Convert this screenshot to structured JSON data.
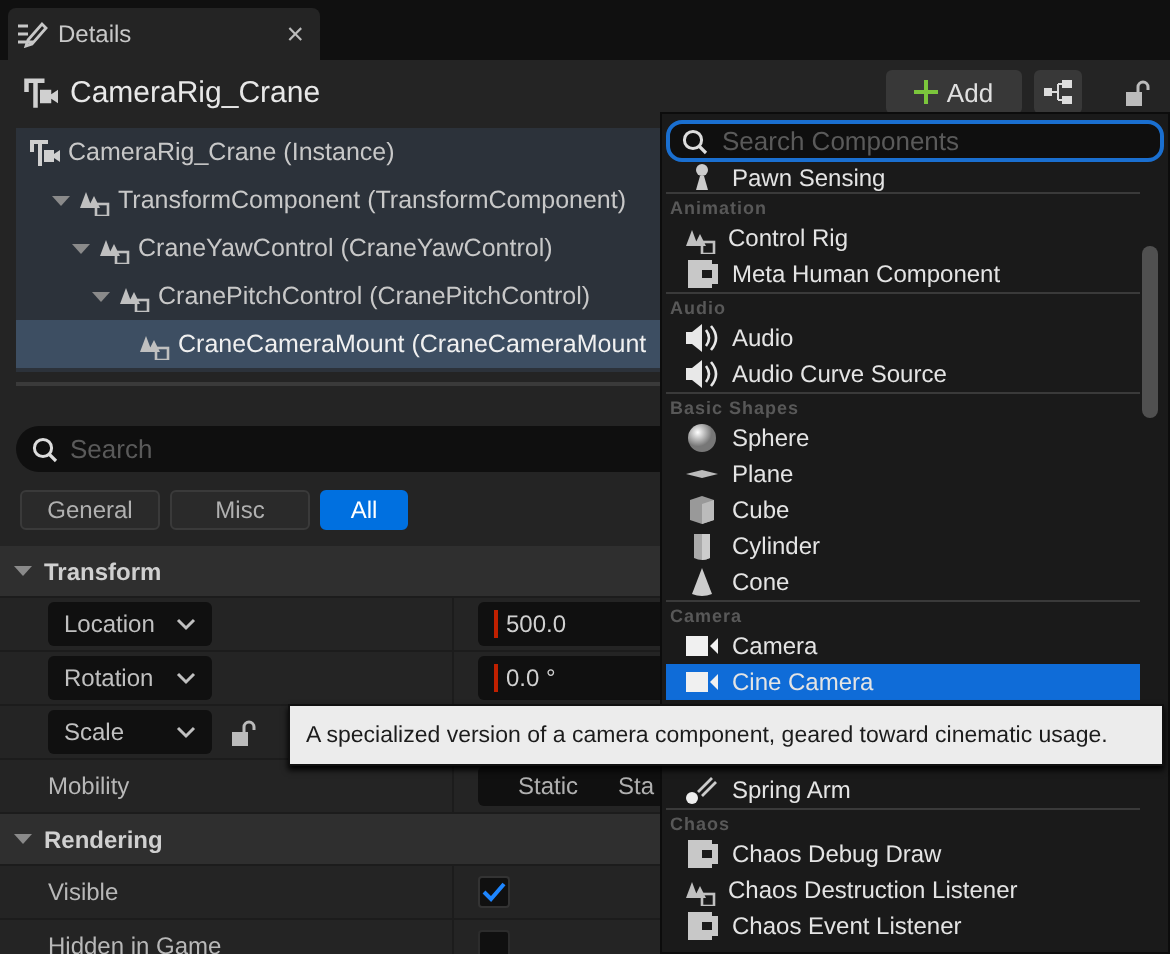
{
  "tab": {
    "title": "Details",
    "close": "×"
  },
  "header": {
    "title": "CameraRig_Crane",
    "add_button": "Add"
  },
  "tree": [
    {
      "label": "CameraRig_Crane (Instance)",
      "kind": "actor",
      "selected": false,
      "children": [
        {
          "label": "TransformComponent (TransformComponent)",
          "kind": "component",
          "expanded": true,
          "selected": false,
          "children": [
            {
              "label": "CraneYawControl (CraneYawControl)",
              "kind": "component",
              "expanded": true,
              "selected": false,
              "children": [
                {
                  "label": "CranePitchControl (CranePitchControl)",
                  "kind": "component",
                  "expanded": true,
                  "selected": false,
                  "children": [
                    {
                      "label": "CraneCameraMount (CraneCameraMount",
                      "kind": "component",
                      "selected": true
                    }
                  ]
                }
              ]
            }
          ]
        }
      ]
    }
  ],
  "search": {
    "placeholder": "Search"
  },
  "filters": [
    {
      "label": "General",
      "selected": false
    },
    {
      "label": "Misc",
      "selected": false
    },
    {
      "label": "All",
      "selected": true
    }
  ],
  "sections": [
    {
      "title": "Transform",
      "expanded": true,
      "rows": [
        {
          "label": "Location",
          "kind": "vector",
          "value": "500.0"
        },
        {
          "label": "Rotation",
          "kind": "vector",
          "value": "0.0 °"
        },
        {
          "label": "Scale",
          "kind": "lock"
        },
        {
          "label": "Mobility",
          "kind": "segmented",
          "options": [
            "Static",
            "Sta"
          ]
        }
      ]
    },
    {
      "title": "Rendering",
      "expanded": true,
      "rows": [
        {
          "label": "Visible",
          "kind": "checkbox",
          "checked": true
        },
        {
          "label": "Hidden in Game",
          "kind": "checkbox",
          "checked": false
        }
      ]
    }
  ],
  "add_menu": {
    "placeholder": "Search Components",
    "entries": [
      {
        "kind": "sensor",
        "label": "Pawn Sensing",
        "selected": false
      },
      {
        "kind": "header",
        "label": "Animation"
      },
      {
        "kind": "rig",
        "label": "Control Rig",
        "selected": false
      },
      {
        "kind": "class",
        "label": "Meta Human Component",
        "selected": false
      },
      {
        "kind": "header",
        "label": "Audio"
      },
      {
        "kind": "audio",
        "label": "Audio",
        "selected": false
      },
      {
        "kind": "audio",
        "label": "Audio Curve Source",
        "selected": false
      },
      {
        "kind": "header",
        "label": "Basic Shapes"
      },
      {
        "kind": "sphere",
        "label": "Sphere",
        "selected": false
      },
      {
        "kind": "plane",
        "label": "Plane",
        "selected": false
      },
      {
        "kind": "cube",
        "label": "Cube",
        "selected": false
      },
      {
        "kind": "cylinder",
        "label": "Cylinder",
        "selected": false
      },
      {
        "kind": "cone",
        "label": "Cone",
        "selected": false
      },
      {
        "kind": "header",
        "label": "Camera"
      },
      {
        "kind": "camera",
        "label": "Camera",
        "selected": false
      },
      {
        "kind": "camera",
        "label": "Cine Camera",
        "selected": true
      },
      {
        "kind": "spring",
        "label": "Spring Arm",
        "selected": false
      },
      {
        "kind": "header",
        "label": "Chaos"
      },
      {
        "kind": "class",
        "label": "Chaos Debug Draw",
        "selected": false
      },
      {
        "kind": "rig",
        "label": "Chaos Destruction Listener",
        "selected": false
      },
      {
        "kind": "class",
        "label": "Chaos Event Listener",
        "selected": false
      }
    ]
  },
  "tooltip": {
    "text": "A specialized version of a camera component, geared toward cinematic usage."
  }
}
